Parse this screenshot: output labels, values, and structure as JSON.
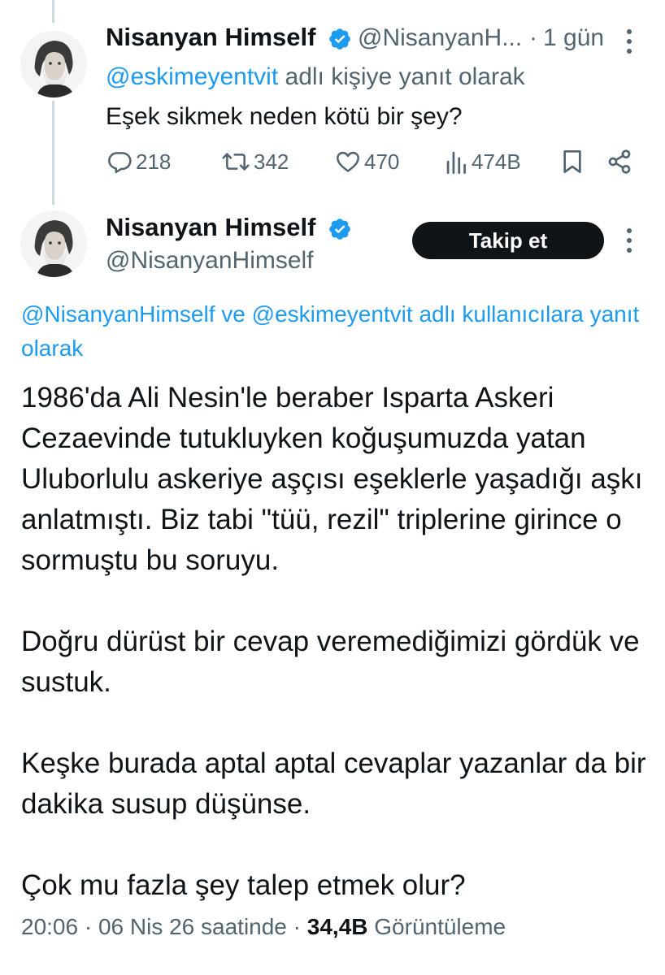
{
  "parent_tweet": {
    "display_name": "Nisanyan Himself",
    "handle": "@NisanyanH...",
    "separator": "·",
    "time": "1 gün",
    "reply_to_handle": "@eskimeyentvit",
    "reply_to_suffix": " adlı kişiye yanıt olarak",
    "text": "Eşek sikmek neden kötü bir şey?",
    "actions": {
      "replies": "218",
      "retweets": "342",
      "likes": "470",
      "views": "474B"
    }
  },
  "main_tweet": {
    "display_name": "Nisanyan Himself",
    "handle": "@NisanyanHimself",
    "follow_label": "Takip et",
    "reply_handle_1": "@NisanyanHimself",
    "reply_connector": " ve ",
    "reply_handle_2": "@eskimeyentvit",
    "reply_suffix": " adlı kullanıcılara yanıt olarak",
    "paragraphs": [
      "1986'da Ali Nesin'le beraber Isparta Askeri Cezaevinde tutukluyken koğuşumuzda yatan Uluborlulu askeriye aşçısı eşeklerle yaşadığı aşkı anlatmıştı. Biz tabi \"tüü, rezil\" triplerine girince o sormuştu bu soruyu.",
      "Doğru dürüst bir cevap veremediğimizi gördük ve sustuk.",
      "Keşke burada aptal aptal cevaplar yazanlar da bir dakika susup düşünse.",
      "Çok mu fazla şey talep etmek olur?"
    ],
    "timestamp": "20:06 · 06 Nis 26 saatinde · ",
    "views_count": "34,4B",
    "views_label": " Görüntüleme"
  },
  "colors": {
    "text_primary": "#0f1419",
    "text_secondary": "#536471",
    "link": "#1d9bf0",
    "verified": "#1d9bf0",
    "button_bg": "#0f1419",
    "thread_line": "#cfd9de"
  },
  "icons": {
    "verified": "verified-badge-icon",
    "more": "more-icon",
    "reply": "reply-icon",
    "retweet": "retweet-icon",
    "like": "heart-icon",
    "views": "views-chart-icon",
    "bookmark": "bookmark-icon",
    "share": "share-icon"
  }
}
